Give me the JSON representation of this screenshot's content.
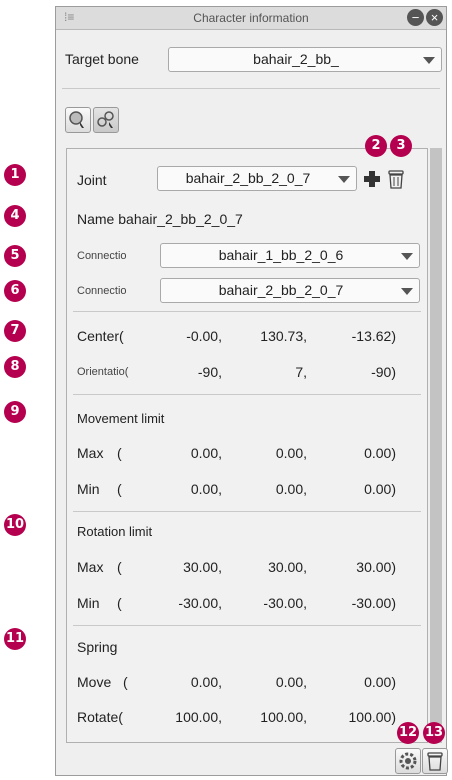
{
  "title": "Character information",
  "target_bone": {
    "label": "Target bone",
    "value": "bahair_2_bb_"
  },
  "joint": {
    "label": "Joint",
    "value": "bahair_2_bb_2_0_7"
  },
  "name": {
    "label": "Name",
    "value": "bahair_2_bb_2_0_7"
  },
  "connection1": {
    "label": "Connectio",
    "value": "bahair_1_bb_2_0_6"
  },
  "connection2": {
    "label": "Connectio",
    "value": "bahair_2_bb_2_0_7"
  },
  "center": {
    "label": "Center(",
    "x": "-0.00,",
    "y": "130.73,",
    "z": "-13.62)"
  },
  "orientation": {
    "label": "Orientatio(",
    "x": "-90,",
    "y": "7,",
    "z": "-90)"
  },
  "movement_limit": {
    "title": "Movement limit",
    "max": {
      "label": "Max",
      "paren": "(",
      "x": "0.00,",
      "y": "0.00,",
      "z": "0.00)"
    },
    "min": {
      "label": "Min",
      "paren": "(",
      "x": "0.00,",
      "y": "0.00,",
      "z": "0.00)"
    }
  },
  "rotation_limit": {
    "title": "Rotation limit",
    "max": {
      "label": "Max",
      "paren": "(",
      "x": "30.00,",
      "y": "30.00,",
      "z": "30.00)"
    },
    "min": {
      "label": "Min",
      "paren": "(",
      "x": "-30.00,",
      "y": "-30.00,",
      "z": "-30.00)"
    }
  },
  "spring": {
    "title": "Spring",
    "move": {
      "label": "Move",
      "paren": "(",
      "x": "0.00,",
      "y": "0.00,",
      "z": "0.00)"
    },
    "rotate": {
      "label": "Rotate(",
      "x": "100.00,",
      "y": "100.00,",
      "z": "100.00)"
    }
  },
  "badges": [
    "1",
    "2",
    "3",
    "4",
    "5",
    "6",
    "7",
    "8",
    "9",
    "10",
    "11",
    "12",
    "13"
  ],
  "colors": {
    "badge": "#b5004f"
  }
}
